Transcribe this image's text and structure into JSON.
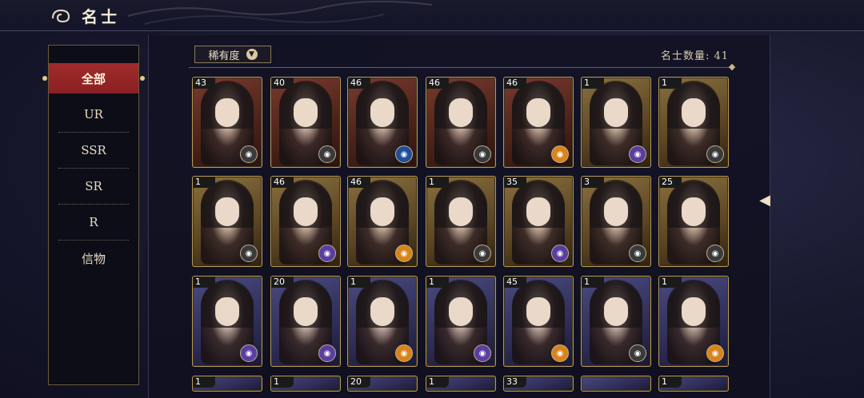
{
  "header": {
    "title": "名士"
  },
  "sidebar": {
    "tabs": [
      {
        "label": "全部",
        "active": true
      },
      {
        "label": "UR"
      },
      {
        "label": "SSR"
      },
      {
        "label": "SR"
      },
      {
        "label": "R"
      },
      {
        "label": "信物"
      }
    ]
  },
  "filter": {
    "label": "稀有度"
  },
  "count": {
    "text": "名士数量: 41"
  },
  "cards": [
    {
      "level": "43",
      "tone": "red",
      "badge": "gray"
    },
    {
      "level": "40",
      "tone": "red",
      "badge": "gray"
    },
    {
      "level": "46",
      "tone": "red",
      "badge": "blue"
    },
    {
      "level": "46",
      "tone": "red",
      "badge": "gray"
    },
    {
      "level": "46",
      "tone": "red",
      "badge": "orange"
    },
    {
      "level": "1",
      "tone": "gold",
      "badge": "purple"
    },
    {
      "level": "1",
      "tone": "gold",
      "badge": "gray"
    },
    {
      "level": "1",
      "tone": "gold",
      "badge": "gray"
    },
    {
      "level": "46",
      "tone": "gold",
      "badge": "purple"
    },
    {
      "level": "46",
      "tone": "gold",
      "badge": "orange"
    },
    {
      "level": "1",
      "tone": "gold",
      "badge": "gray"
    },
    {
      "level": "35",
      "tone": "gold",
      "badge": "purple"
    },
    {
      "level": "3",
      "tone": "gold",
      "badge": "gray"
    },
    {
      "level": "25",
      "tone": "gold",
      "badge": "gray"
    },
    {
      "level": "1",
      "tone": "blue",
      "badge": "purple"
    },
    {
      "level": "20",
      "tone": "blue",
      "badge": "purple"
    },
    {
      "level": "1",
      "tone": "blue",
      "badge": "orange"
    },
    {
      "level": "1",
      "tone": "blue",
      "badge": "purple"
    },
    {
      "level": "45",
      "tone": "blue",
      "badge": "orange"
    },
    {
      "level": "1",
      "tone": "blue",
      "badge": "gray"
    },
    {
      "level": "1",
      "tone": "blue",
      "badge": "orange"
    },
    {
      "level": "1",
      "tone": "blue"
    },
    {
      "level": "1",
      "tone": "blue"
    },
    {
      "level": "20",
      "tone": "blue"
    },
    {
      "level": "1",
      "tone": "blue"
    },
    {
      "level": "33",
      "tone": "blue"
    },
    {
      "level": "",
      "tone": "blue"
    },
    {
      "level": "1",
      "tone": "blue"
    }
  ]
}
